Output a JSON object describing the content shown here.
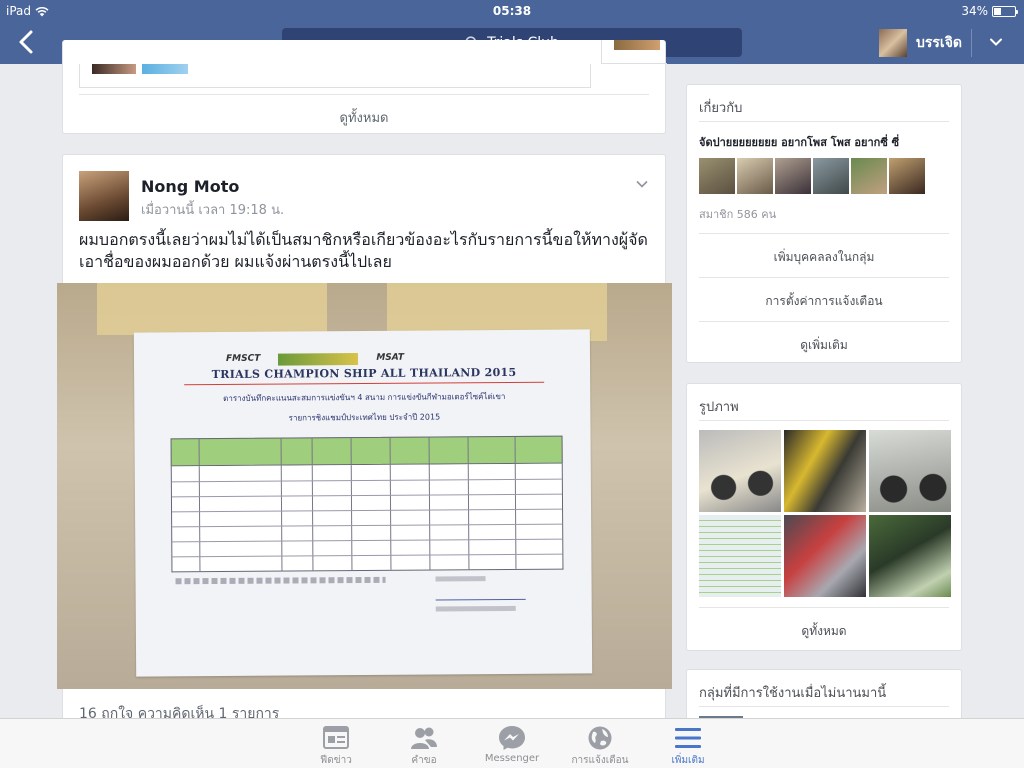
{
  "status_bar": {
    "carrier": "iPad",
    "time": "05:38",
    "battery": "34%",
    "battery_level": 0.34
  },
  "nav": {
    "search_text": "Trials Club",
    "profile_name": "บรรเจิด"
  },
  "suggest_card": {
    "see_all": "ดูทั้งหมด"
  },
  "post": {
    "author": "Nong Moto",
    "time": "เมื่อวานนี้ เวลา 19:18 น.",
    "text": "ผมบอกตรงนี้เลยว่าผมไม่ได้เป็นสมาชิกหรือเกียวข้องอะไรกับรายการนี้ขอให้ทางผู้จัดเอาชื่อของผมออกด้วย  ผมแจ้งผ่านตรงนี้ไปเลย",
    "image": {
      "logos": [
        "FMSCT",
        "MSAT"
      ],
      "title": "TRIALS CHAMPION SHIP ALL THAILAND 2015",
      "subtitle1": "ตารางบันทึกคะแนนสะสมการแข่งขันฯ 4 สนาม การแข่งขันกีฬามอเตอร์ไซค์ไต่เขา",
      "subtitle2": "รายการชิงแชมป์ประเทศไทย ประจำปี 2015"
    },
    "stats": "16 ถูกใจ  ความคิดเห็น 1 รายการ"
  },
  "about": {
    "title": "เกี่ยวกับ",
    "group_name": "จัดปายยยยยยยย อยากโพส โพส อยากซี่ ซี่",
    "member_count": "สมาชิก 586 คน",
    "add_member": "เพิ่มบุคคลลงในกลุ่ม",
    "notification_settings": "การตั้งค่าการแจ้งเตือน",
    "see_more": "ดูเพิ่มเติม"
  },
  "photos": {
    "title": "รูปภาพ",
    "see_all": "ดูทั้งหมด"
  },
  "groups": {
    "title": "กลุ่มที่มีการใช้งานเมื่อไม่นานมานี้"
  },
  "tabbar": {
    "tabs": [
      {
        "label": "ฟีดข่าว",
        "icon": "news-feed-icon"
      },
      {
        "label": "คำขอ",
        "icon": "friend-requests-icon"
      },
      {
        "label": "Messenger",
        "icon": "messenger-icon"
      },
      {
        "label": "การแจ้งเตือน",
        "icon": "globe-notifications-icon"
      },
      {
        "label": "เพิ่มเติม",
        "icon": "menu-icon"
      }
    ],
    "active_tab": "เพิ่มเติม"
  },
  "colors": {
    "nav_bar": "#4a659a",
    "search_bg": "#2f4374",
    "active_tab": "#4a76c9",
    "page_bg": "#e9ebee"
  }
}
